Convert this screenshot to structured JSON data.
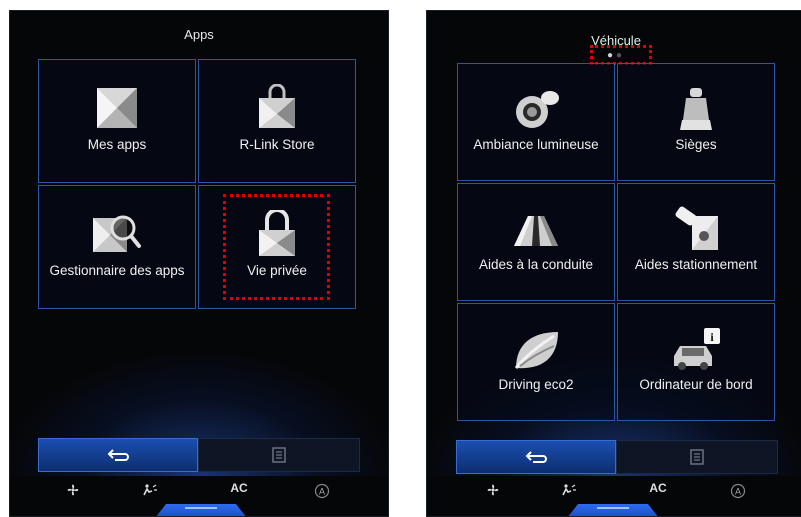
{
  "left_screen": {
    "title": "Apps",
    "tiles": [
      {
        "label": "Mes apps",
        "icon": "mes-apps-icon"
      },
      {
        "label": "R-Link Store",
        "icon": "shopping-bag-icon"
      },
      {
        "label": "Gestionnaire des apps",
        "icon": "app-manager-magnifier-icon"
      },
      {
        "label": "Vie privée",
        "icon": "padlock-icon"
      }
    ]
  },
  "right_screen": {
    "title": "Véhicule",
    "page_dots": 2,
    "active_dot": 1,
    "tiles": [
      {
        "label": "Ambiance lumineuse",
        "icon": "ambient-light-icon"
      },
      {
        "label": "Sièges",
        "icon": "seat-icon"
      },
      {
        "label": "Aides à la conduite",
        "icon": "road-lanes-icon"
      },
      {
        "label": "Aides stationnement",
        "icon": "parking-camera-icon"
      },
      {
        "label": "Driving eco2",
        "icon": "eco-leaf-icon"
      },
      {
        "label": "Ordinateur de bord",
        "icon": "trip-computer-info-icon"
      }
    ]
  },
  "bottom_bar": {
    "back_icon": "back-arrow-icon",
    "list_icon": "list-icon"
  },
  "climate_bar": {
    "fan_icon": "fan-icon",
    "airflow_icon": "airflow-icon",
    "ac_label": "AC",
    "auto_icon": "auto-climate-icon"
  },
  "colors": {
    "accent": "#2c56a8",
    "highlight": "#e00000",
    "background": "#050608"
  }
}
